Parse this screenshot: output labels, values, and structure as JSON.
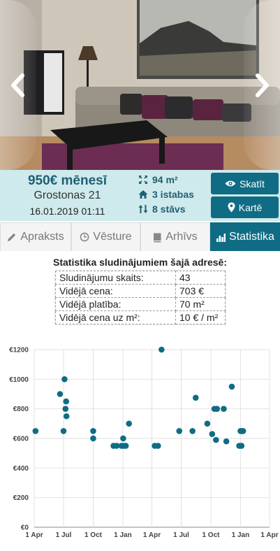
{
  "listing": {
    "price": "950€ mēnesī",
    "address": "Grostonas 21",
    "date": "16.01.2019 01:11",
    "area": "94 m²",
    "rooms": "3 istabas",
    "floor": "8 stāvs"
  },
  "buttons": {
    "view": "Skatīt",
    "map": "Kartē"
  },
  "icons": {
    "prev": "chevron-left-icon",
    "next": "chevron-right-icon",
    "area": "expand-icon",
    "rooms": "home-icon",
    "floor": "sort-icon",
    "view": "eye-icon",
    "map": "map-marker-icon",
    "description": "pencil-icon",
    "history": "clock-icon",
    "archive": "book-icon",
    "statistics": "bar-chart-icon"
  },
  "tabs": [
    {
      "label": "Apraksts",
      "active": false
    },
    {
      "label": "Vēsture",
      "active": false
    },
    {
      "label": "Arhīvs",
      "active": false
    },
    {
      "label": "Statistika",
      "active": true
    }
  ],
  "stats": {
    "title": "Statistika sludinājumiem šajā adresē:",
    "rows": [
      {
        "label": "Sludinājumu skaits:",
        "value": "43"
      },
      {
        "label": "Vidējā cena:",
        "value": "703 €"
      },
      {
        "label": "Vidējā platība:",
        "value": "70 m²"
      },
      {
        "label": "Vidējā cena uz m²:",
        "value": "10 € / m²"
      }
    ]
  },
  "colors": {
    "accent": "#0f6c84",
    "info_bg": "#cfeaec",
    "price_text": "#1f5f73",
    "point": "#0f6c84"
  },
  "chart_data": {
    "type": "scatter",
    "title": "",
    "xlabel": "",
    "ylabel": "",
    "ylim": [
      0,
      1200
    ],
    "xlim": [
      "2017-04-01",
      "2019-04-01"
    ],
    "yticks": [
      "€0",
      "€200",
      "€400",
      "€600",
      "€800",
      "€1000",
      "€1200"
    ],
    "xticks": [
      "1 Apr",
      "1 Jul",
      "1 Oct",
      "1 Jan",
      "1 Apr",
      "1 Jul",
      "1 Oct",
      "1 Jan",
      "1 Apr"
    ],
    "grid": true,
    "points": [
      {
        "x": "2017-04-05",
        "y": 650
      },
      {
        "x": "2017-06-20",
        "y": 900
      },
      {
        "x": "2017-07-01",
        "y": 650
      },
      {
        "x": "2017-07-04",
        "y": 1000
      },
      {
        "x": "2017-07-07",
        "y": 800
      },
      {
        "x": "2017-07-09",
        "y": 850
      },
      {
        "x": "2017-07-10",
        "y": 750
      },
      {
        "x": "2017-10-01",
        "y": 650
      },
      {
        "x": "2017-10-01",
        "y": 600
      },
      {
        "x": "2017-12-03",
        "y": 550
      },
      {
        "x": "2017-12-13",
        "y": 550
      },
      {
        "x": "2017-12-28",
        "y": 550
      },
      {
        "x": "2018-01-02",
        "y": 600
      },
      {
        "x": "2018-01-04",
        "y": 550
      },
      {
        "x": "2018-01-10",
        "y": 550
      },
      {
        "x": "2018-01-20",
        "y": 700
      },
      {
        "x": "2018-04-10",
        "y": 550
      },
      {
        "x": "2018-04-20",
        "y": 550
      },
      {
        "x": "2018-05-01",
        "y": 1200
      },
      {
        "x": "2018-06-25",
        "y": 650
      },
      {
        "x": "2018-08-05",
        "y": 650
      },
      {
        "x": "2018-08-15",
        "y": 875
      },
      {
        "x": "2018-09-20",
        "y": 700
      },
      {
        "x": "2018-10-05",
        "y": 630
      },
      {
        "x": "2018-10-12",
        "y": 800
      },
      {
        "x": "2018-10-17",
        "y": 590
      },
      {
        "x": "2018-10-20",
        "y": 800
      },
      {
        "x": "2018-11-10",
        "y": 800
      },
      {
        "x": "2018-11-18",
        "y": 580
      },
      {
        "x": "2018-12-05",
        "y": 950
      },
      {
        "x": "2018-12-28",
        "y": 550
      },
      {
        "x": "2019-01-01",
        "y": 650
      },
      {
        "x": "2019-01-04",
        "y": 550
      },
      {
        "x": "2019-01-06",
        "y": 650
      },
      {
        "x": "2019-01-09",
        "y": 650
      }
    ]
  }
}
